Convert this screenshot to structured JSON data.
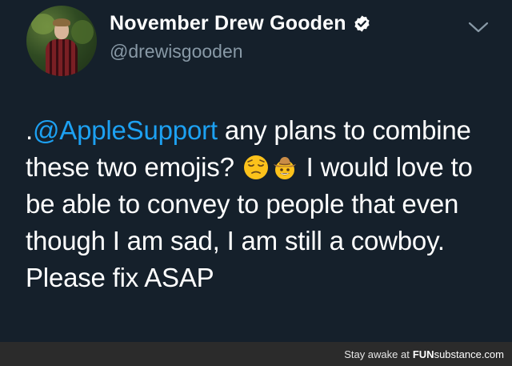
{
  "user": {
    "display_name": "November Drew Gooden",
    "handle": "@drewisgooden",
    "verified": true
  },
  "tweet": {
    "prefix": ".",
    "mention": "@AppleSupport",
    "part1": " any plans to combine these two emojis? ",
    "emojis": [
      "pensive-face-emoji",
      "cowboy-hat-face-emoji"
    ],
    "part2": " I would love to be able to convey to people that even though I am sad, I am still a cowboy. Please fix ASAP"
  },
  "watermark": {
    "lead": "Stay awake at",
    "brand_fun": "FUN",
    "brand_rest": "substance.com"
  },
  "colors": {
    "background": "#15202b",
    "mention": "#1da1f2",
    "handle": "#8899a6",
    "verified": "#ffffff"
  }
}
